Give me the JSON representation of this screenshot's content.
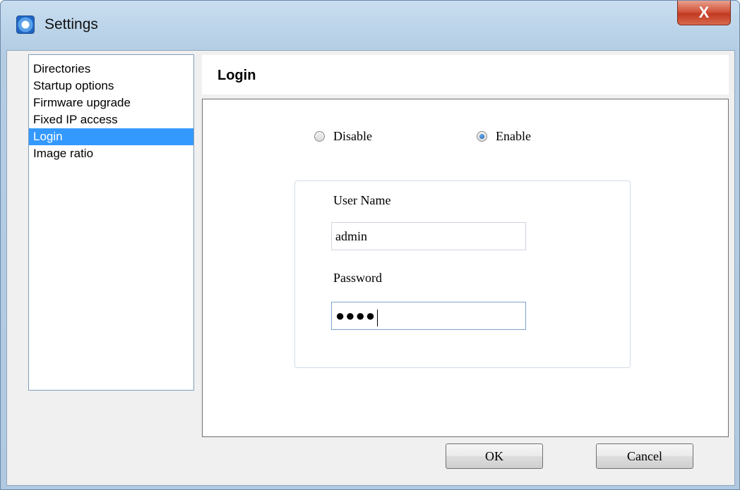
{
  "window": {
    "title": "Settings",
    "close_label": "X"
  },
  "sidebar": {
    "items": [
      {
        "label": "Directories"
      },
      {
        "label": "Startup options"
      },
      {
        "label": "Firmware upgrade"
      },
      {
        "label": "Fixed IP access"
      },
      {
        "label": "Login",
        "selected": true
      },
      {
        "label": "Image ratio"
      }
    ]
  },
  "panel": {
    "title": "Login",
    "login_mode": {
      "options": [
        "Disable",
        "Enable"
      ],
      "selected": "Enable"
    },
    "username": {
      "label": "User Name",
      "value": "admin"
    },
    "password": {
      "label": "Password",
      "masked_value": "●●●●"
    }
  },
  "buttons": {
    "ok": "OK",
    "cancel": "Cancel"
  }
}
